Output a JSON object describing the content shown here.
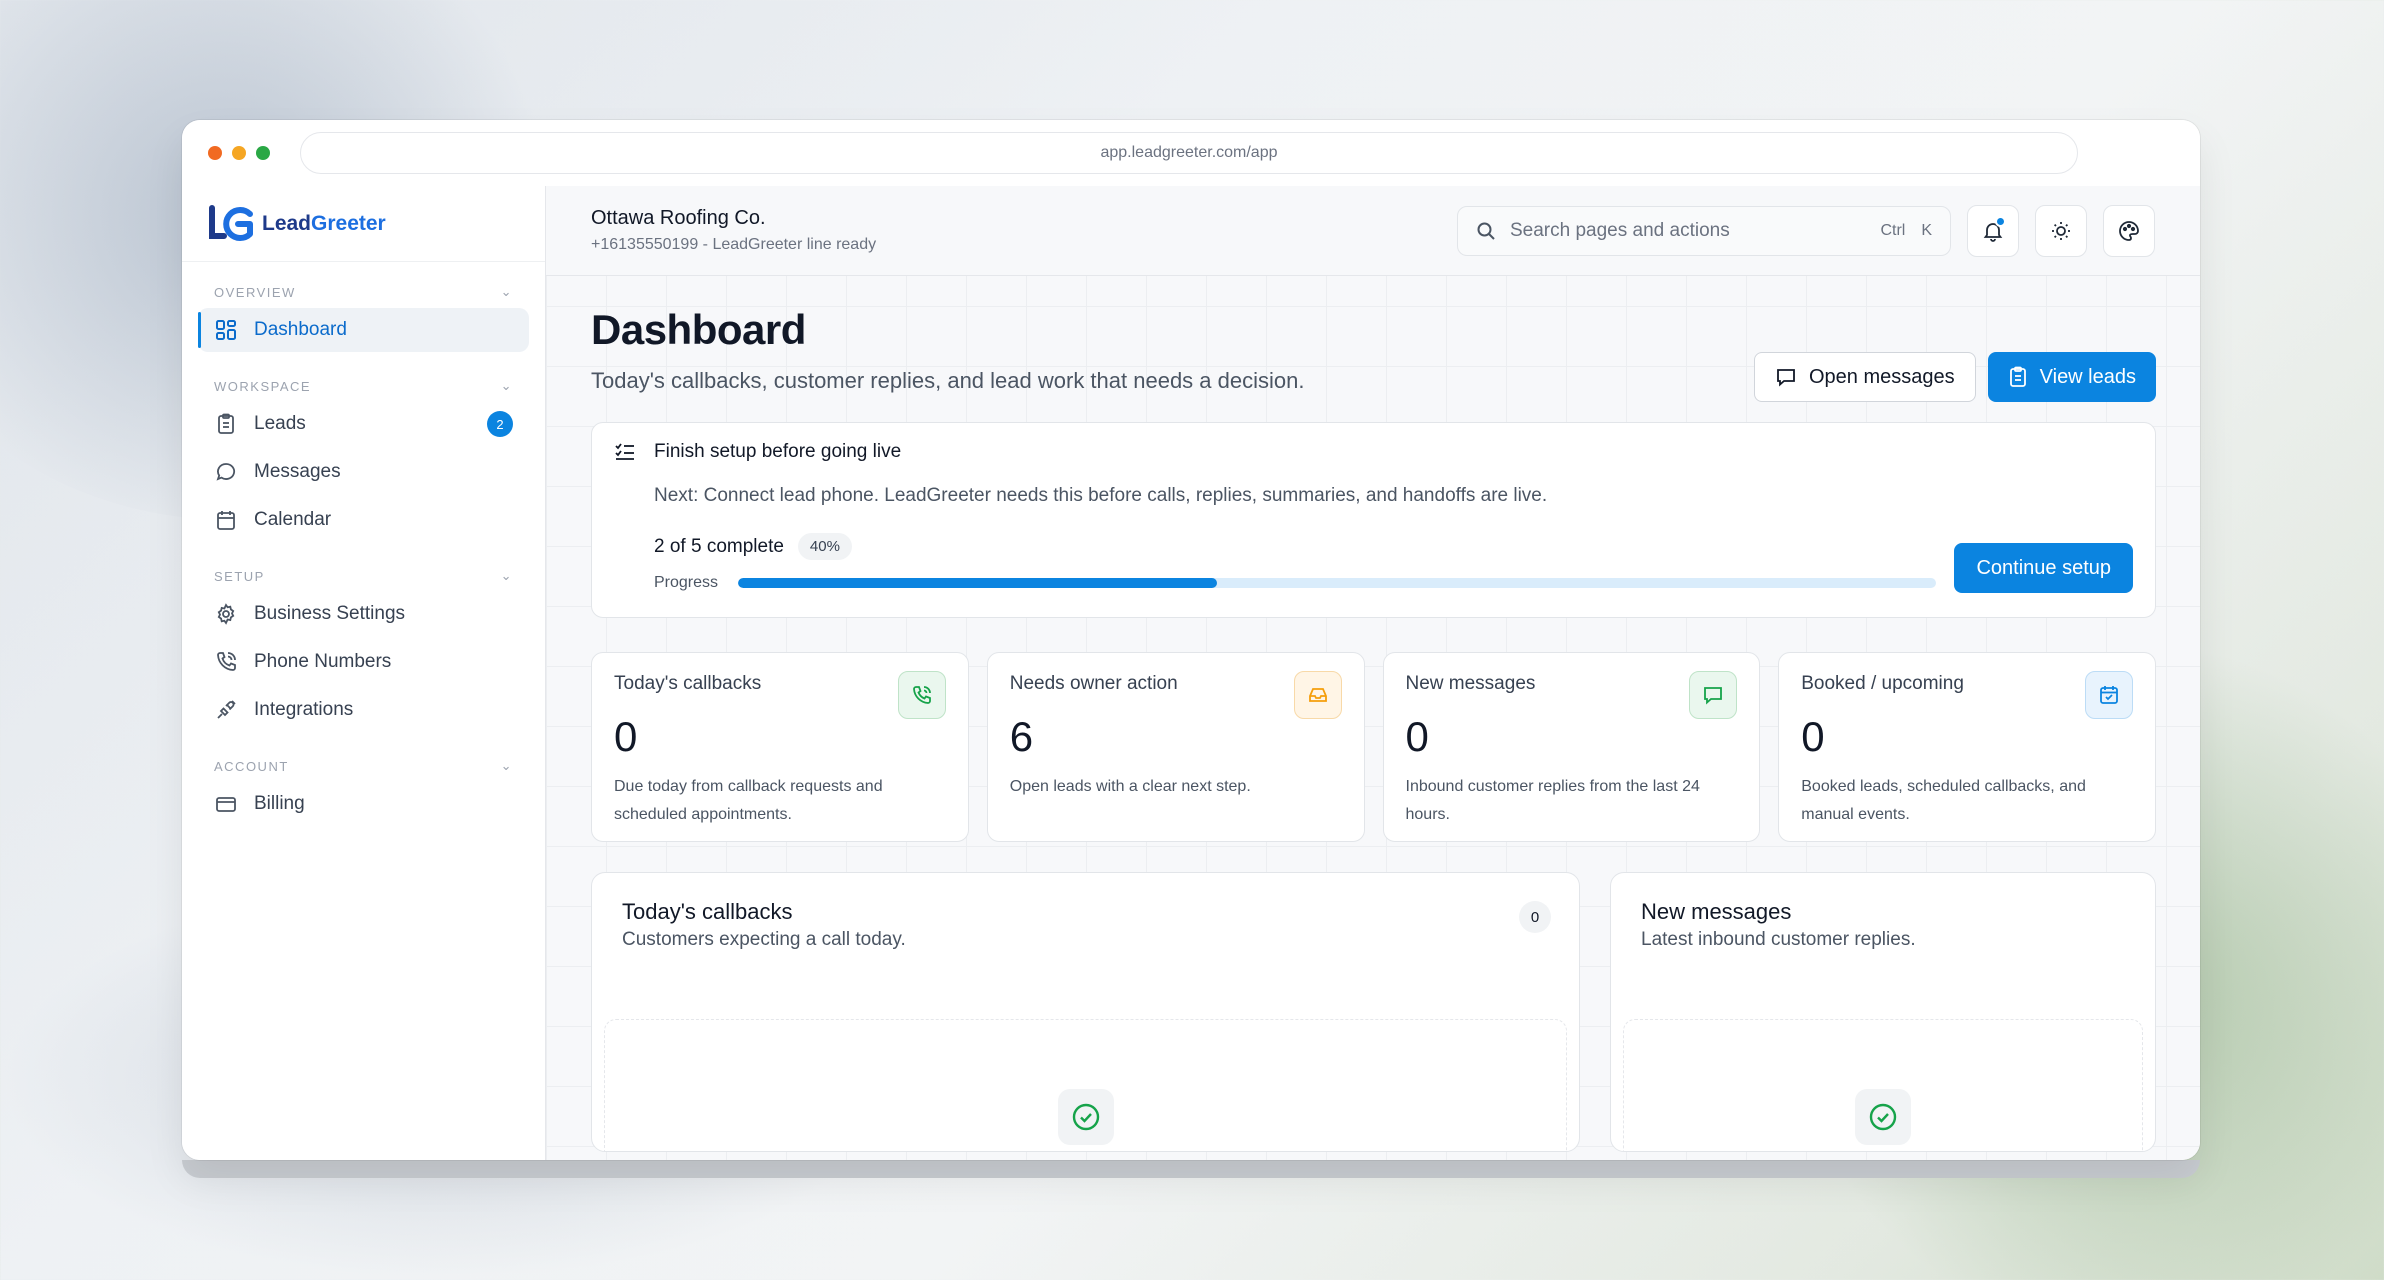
{
  "browser": {
    "url": "app.leadgreeter.com/app",
    "dot_colors": [
      "#f16a22",
      "#f5a623",
      "#2aa845"
    ]
  },
  "brand": {
    "name_part1": "Lead",
    "name_part2": "Greeter",
    "accent": "#0b84e0"
  },
  "sidebar": {
    "sections": [
      {
        "title": "OVERVIEW",
        "items": [
          {
            "label": "Dashboard",
            "icon": "grid-icon",
            "active": true
          }
        ]
      },
      {
        "title": "WORKSPACE",
        "items": [
          {
            "label": "Leads",
            "icon": "clipboard-icon",
            "badge": "2"
          },
          {
            "label": "Messages",
            "icon": "message-icon"
          },
          {
            "label": "Calendar",
            "icon": "calendar-icon"
          }
        ]
      },
      {
        "title": "SETUP",
        "items": [
          {
            "label": "Business Settings",
            "icon": "gear-icon"
          },
          {
            "label": "Phone Numbers",
            "icon": "phone-icon"
          },
          {
            "label": "Integrations",
            "icon": "plug-icon"
          }
        ]
      },
      {
        "title": "ACCOUNT",
        "items": [
          {
            "label": "Billing",
            "icon": "credit-card-icon"
          }
        ]
      }
    ]
  },
  "header": {
    "business_name": "Ottawa Roofing Co.",
    "business_sub": "+16135550199 - LeadGreeter line ready",
    "search_placeholder": "Search pages and actions",
    "search_kbd_1": "Ctrl",
    "search_kbd_2": "K"
  },
  "page": {
    "title": "Dashboard",
    "subtitle": "Today's callbacks, customer replies, and lead work that needs a decision.",
    "open_messages_label": "Open messages",
    "view_leads_label": "View leads"
  },
  "setup": {
    "title": "Finish setup before going live",
    "next": "Next: Connect lead phone. LeadGreeter needs this before calls, replies, summaries, and handoffs are live.",
    "complete_text": "2 of 5 complete",
    "percent_label": "40%",
    "progress_fraction": 0.4,
    "progress_label": "Progress",
    "continue_label": "Continue setup"
  },
  "stats": [
    {
      "label": "Today's callbacks",
      "value": "0",
      "desc": "Due today from callback requests and scheduled appointments.",
      "icon": "phone-call-icon",
      "icon_color": "#16a34a",
      "icon_bg": "#eaf7ee"
    },
    {
      "label": "Needs owner action",
      "value": "6",
      "desc": "Open leads with a clear next step.",
      "icon": "inbox-icon",
      "icon_color": "#f59e0b",
      "icon_bg": "#fff5e6"
    },
    {
      "label": "New messages",
      "value": "0",
      "desc": "Inbound customer replies from the last 24 hours.",
      "icon": "message-square-icon",
      "icon_color": "#16a34a",
      "icon_bg": "#eaf7ee"
    },
    {
      "label": "Booked / upcoming",
      "value": "0",
      "desc": "Booked leads, scheduled callbacks, and manual events.",
      "icon": "calendar-check-icon",
      "icon_color": "#0b84e0",
      "icon_bg": "#e8f3fd"
    }
  ],
  "panels": {
    "callbacks": {
      "title": "Today's callbacks",
      "subtitle": "Customers expecting a call today.",
      "count": "0"
    },
    "messages": {
      "title": "New messages",
      "subtitle": "Latest inbound customer replies."
    }
  }
}
